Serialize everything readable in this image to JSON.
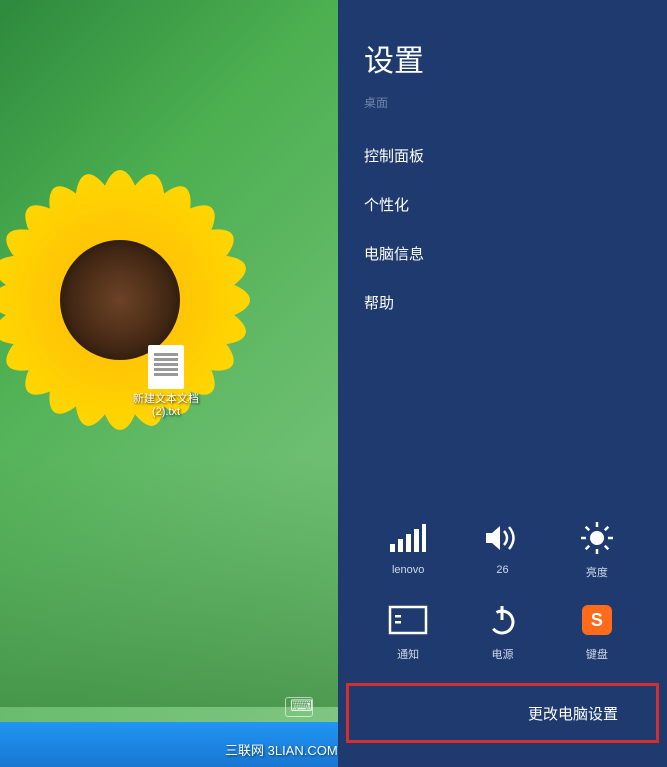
{
  "desktop": {
    "file_name": "新建文本文档 (2).txt",
    "watermark": "三联网 3LIAN.COM"
  },
  "panel": {
    "title": "设置",
    "subtitle": "桌面",
    "links": {
      "control_panel": "控制面板",
      "personalization": "个性化",
      "pc_info": "电脑信息",
      "help": "帮助"
    },
    "tiles": {
      "network": {
        "label": "lenovo",
        "icon": "signal-bars-icon"
      },
      "volume": {
        "label": "26",
        "icon": "speaker-icon"
      },
      "brightness": {
        "label": "亮度",
        "icon": "brightness-icon"
      },
      "notifications": {
        "label": "通知",
        "icon": "notifications-icon"
      },
      "power": {
        "label": "电源",
        "icon": "power-icon"
      },
      "keyboard": {
        "label": "键盘",
        "icon": "ime-icon",
        "badge": "S"
      }
    },
    "change_pc_settings": "更改电脑设置"
  }
}
